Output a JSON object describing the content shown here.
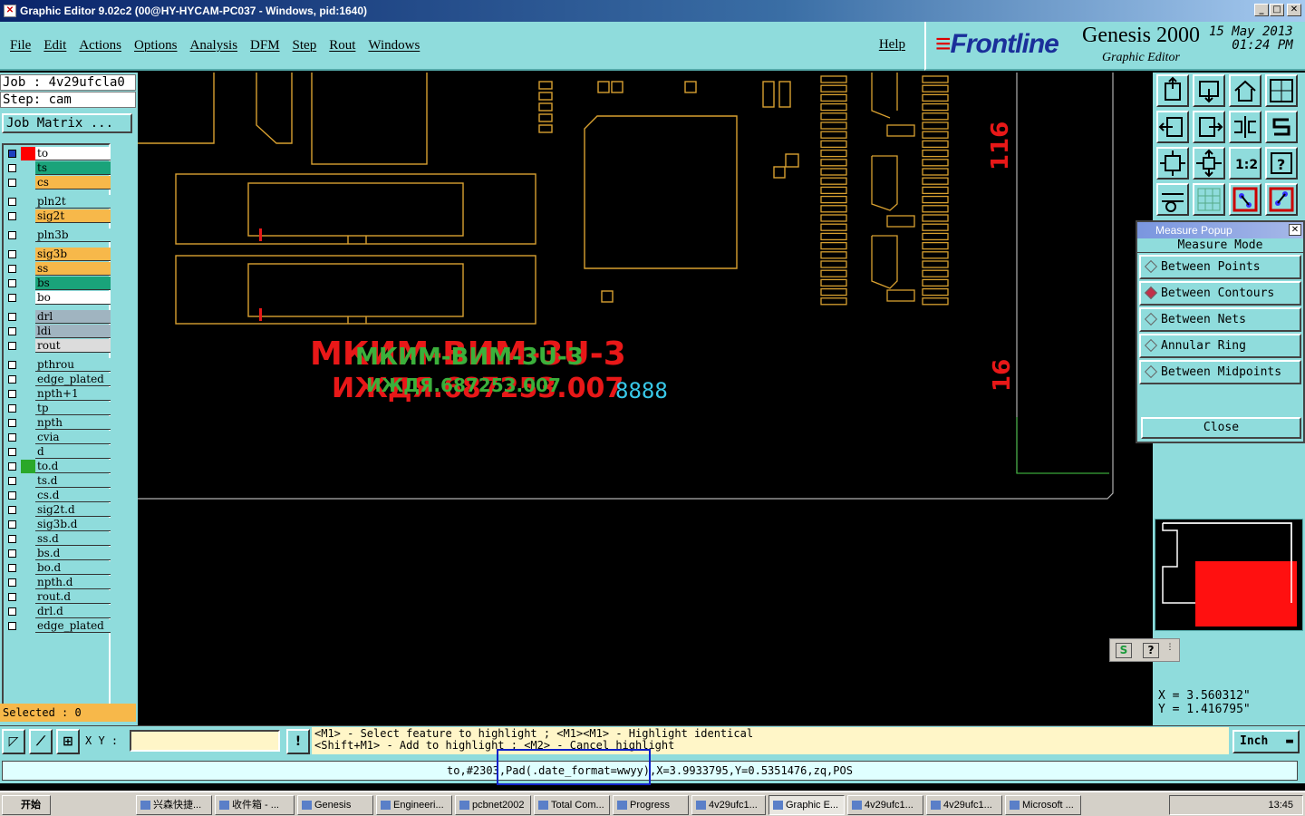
{
  "window": {
    "title": "Graphic Editor 9.02c2 (00@HY-HYCAM-PC037 - Windows, pid:1640)"
  },
  "menu": {
    "items": [
      "File",
      "Edit",
      "Actions",
      "Options",
      "Analysis",
      "DFM",
      "Step",
      "Rout",
      "Windows"
    ],
    "help": "Help"
  },
  "brand": {
    "logo": "Frontline",
    "product": "Genesis 2000",
    "subtitle": "Graphic Editor",
    "date": "15 May 2013",
    "time": "01:24 PM"
  },
  "job": {
    "job_label": "Job : 4v29ufcla0",
    "step_label": "Step: cam",
    "matrix_button": "Job Matrix ..."
  },
  "layers": [
    {
      "name": "to",
      "color": "#ffffff",
      "swatch": "#ff0000"
    },
    {
      "name": "ts",
      "color": "#1aa37a",
      "swatch": "#8fdcdc"
    },
    {
      "name": "cs",
      "color": "#f7b84a",
      "swatch": "#8fdcdc"
    },
    {
      "name": "pln2t",
      "color": "#8fdcdc",
      "swatch": "#8fdcdc"
    },
    {
      "name": "sig2t",
      "color": "#f7b84a",
      "swatch": "#8fdcdc"
    },
    {
      "name": "pln3b",
      "color": "#8fdcdc",
      "swatch": "#8fdcdc"
    },
    {
      "name": "sig3b",
      "color": "#f7b84a",
      "swatch": "#8fdcdc"
    },
    {
      "name": "ss",
      "color": "#f7b84a",
      "swatch": "#8fdcdc"
    },
    {
      "name": "bs",
      "color": "#1aa37a",
      "swatch": "#8fdcdc"
    },
    {
      "name": "bo",
      "color": "#ffffff",
      "swatch": "#8fdcdc"
    },
    {
      "name": "drl",
      "color": "#a0b4c0",
      "swatch": "#8fdcdc"
    },
    {
      "name": "ldi",
      "color": "#a0b4c0",
      "swatch": "#8fdcdc"
    },
    {
      "name": "rout",
      "color": "#dcdcdc",
      "swatch": "#8fdcdc"
    },
    {
      "name": "pthrou",
      "color": "#8fdcdc",
      "swatch": "#8fdcdc"
    },
    {
      "name": "edge_plated",
      "color": "#8fdcdc",
      "swatch": "#8fdcdc"
    },
    {
      "name": "npth+1",
      "color": "#8fdcdc",
      "swatch": "#8fdcdc"
    },
    {
      "name": "tp",
      "color": "#8fdcdc",
      "swatch": "#8fdcdc"
    },
    {
      "name": "npth",
      "color": "#8fdcdc",
      "swatch": "#8fdcdc"
    },
    {
      "name": "cvia",
      "color": "#8fdcdc",
      "swatch": "#8fdcdc"
    },
    {
      "name": "d",
      "color": "#8fdcdc",
      "swatch": "#8fdcdc"
    },
    {
      "name": "to.d",
      "color": "#8fdcdc",
      "swatch": "#2aa82a"
    },
    {
      "name": "ts.d",
      "color": "#8fdcdc",
      "swatch": "#8fdcdc"
    },
    {
      "name": "cs.d",
      "color": "#8fdcdc",
      "swatch": "#8fdcdc"
    },
    {
      "name": "sig2t.d",
      "color": "#8fdcdc",
      "swatch": "#8fdcdc"
    },
    {
      "name": "sig3b.d",
      "color": "#8fdcdc",
      "swatch": "#8fdcdc"
    },
    {
      "name": "ss.d",
      "color": "#8fdcdc",
      "swatch": "#8fdcdc"
    },
    {
      "name": "bs.d",
      "color": "#8fdcdc",
      "swatch": "#8fdcdc"
    },
    {
      "name": "bo.d",
      "color": "#8fdcdc",
      "swatch": "#8fdcdc"
    },
    {
      "name": "npth.d",
      "color": "#8fdcdc",
      "swatch": "#8fdcdc"
    },
    {
      "name": "rout.d",
      "color": "#8fdcdc",
      "swatch": "#8fdcdc"
    },
    {
      "name": "drl.d",
      "color": "#8fdcdc",
      "swatch": "#8fdcdc"
    },
    {
      "name": "edge_plated",
      "color": "#8fdcdc",
      "swatch": "#8fdcdc"
    }
  ],
  "selected": "Selected : 0",
  "canvas": {
    "text_red1": "МКИМ-ВИМ-3U-3",
    "text_red2": "ИЖДЯ.687253.007",
    "text_green1": "МКИМ-ВИМ-3U-3",
    "text_green2": "ИЖДЯ.687253.007",
    "cyan_text": "8888",
    "label_116": "116",
    "label_16": "16"
  },
  "measure": {
    "title": "Measure Popup",
    "mode_label": "Measure Mode",
    "options": [
      "Between Points",
      "Between Contours",
      "Between Nets",
      "Annular Ring",
      "Between Midpoints"
    ],
    "selected": "Between Contours",
    "close": "Close"
  },
  "coords": {
    "x": "X = 3.560312\"",
    "y": "Y = 1.416795\""
  },
  "bottom": {
    "xy_label": "X Y :",
    "hint1": "<M1> - Select feature to highlight ; <M1><M1> - Highlight identical",
    "hint2": "<Shift+M1> - Add to highlight ; <M2> - Cancel highlight",
    "unit": "Inch"
  },
  "status": "to,#2303,Pad(.date_format=wwyy),X=3.9933795,Y=0.5351476,zq,POS",
  "taskbar": {
    "start": "开始",
    "tasks": [
      "兴森快捷...",
      "收件箱 - ...",
      "Genesis",
      "Engineeri...",
      "pcbnet2002",
      "Total Com...",
      "Progress",
      "4v29ufc1...",
      "Graphic E...",
      "4v29ufc1...",
      "4v29ufc1...",
      "Microsoft ..."
    ],
    "active": "Graphic E...",
    "clock": "13:45"
  }
}
